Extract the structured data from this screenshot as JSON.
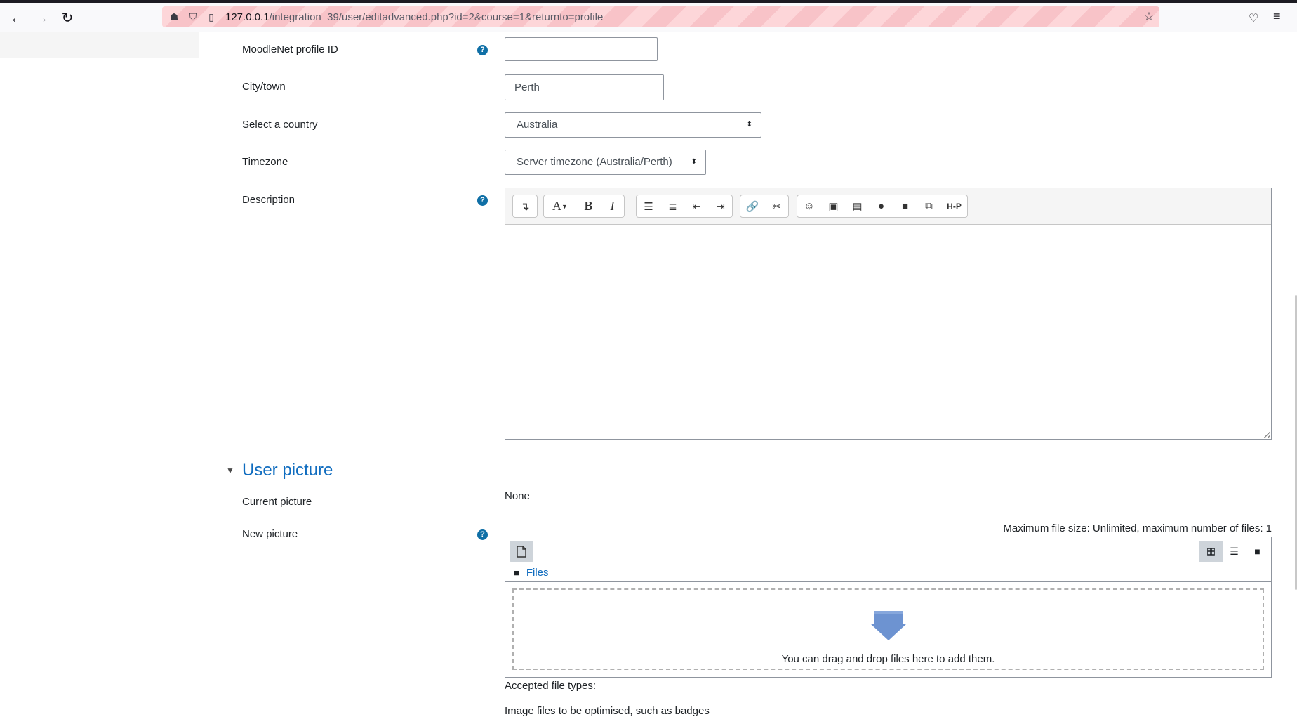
{
  "browser": {
    "url_host": "127.0.0.1",
    "url_path": "/integration_39/user/editadvanced.php?id=2&course=1&returnto=profile"
  },
  "form": {
    "moodlenet": {
      "label": "MoodleNet profile ID",
      "value": ""
    },
    "city": {
      "label": "City/town",
      "value": "Perth"
    },
    "country": {
      "label": "Select a country",
      "selected": "Australia"
    },
    "timezone": {
      "label": "Timezone",
      "selected": "Server timezone (Australia/Perth)"
    },
    "description": {
      "label": "Description",
      "value": ""
    }
  },
  "editor_toolbar": {
    "groups": [
      [
        "collapse-icon"
      ],
      [
        "font-style-icon",
        "bold-icon",
        "italic-icon"
      ],
      [
        "bullet-list-icon",
        "numbered-list-icon",
        "outdent-icon",
        "indent-icon"
      ],
      [
        "link-icon",
        "unlink-icon"
      ],
      [
        "emoji-icon",
        "image-icon",
        "media-icon",
        "record-audio-icon",
        "record-video-icon",
        "manage-files-icon",
        "h5p-icon"
      ]
    ]
  },
  "user_picture": {
    "section_title": "User picture",
    "current_label": "Current picture",
    "current_value": "None",
    "new_label": "New picture",
    "max_size_text": "Maximum file size: Unlimited, maximum number of files: 1",
    "files_label": "Files",
    "drop_text": "You can drag and drop files here to add them.",
    "accepted_label": "Accepted file types:",
    "cut_text": "Image files to be optimised, such as badges"
  },
  "colors": {
    "link": "#0f6cbf",
    "url_stripe": "#fdd6d9"
  }
}
